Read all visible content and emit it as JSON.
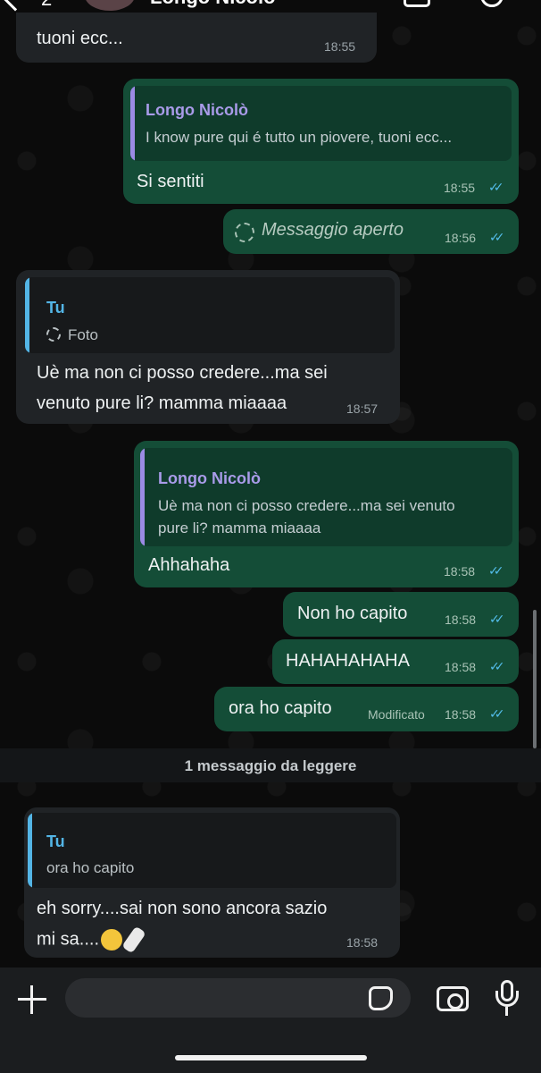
{
  "header": {
    "back_count": "2",
    "contact_name": "Longo Nicolò"
  },
  "messages": [
    {
      "text": "tuoni ecc...",
      "time": "18:55"
    },
    {
      "quote_name": "Longo Nicolò",
      "quote_text": "I know pure qui é tutto un piovere, tuoni ecc...",
      "text": "Si sentiti",
      "time": "18:55",
      "ticks": "✓✓"
    },
    {
      "text": "Messaggio aperto",
      "time": "18:56",
      "ticks": "✓✓"
    },
    {
      "quote_name": "Tu",
      "quote_text": "Foto",
      "text_line1": "Uè ma non ci posso credere...ma sei",
      "text_line2": "venuto pure li? mamma miaaaa",
      "time": "18:57"
    },
    {
      "quote_name": "Longo Nicolò",
      "quote_line1": "Uè ma non ci posso credere...ma sei venuto",
      "quote_line2": "pure li? mamma miaaaa",
      "text": "Ahhahaha",
      "time": "18:58",
      "ticks": "✓✓"
    },
    {
      "text": "Non ho capito",
      "time": "18:58",
      "ticks": "✓✓"
    },
    {
      "text": "HAHAHAHAHA",
      "time": "18:58",
      "ticks": "✓✓"
    },
    {
      "text": "ora ho capito",
      "edited": "Modificato",
      "time": "18:58",
      "ticks": "✓✓"
    }
  ],
  "unread_divider": "1 messaggio da leggere",
  "unread_message": {
    "quote_name": "Tu",
    "quote_text": "ora ho capito",
    "text_line1": "eh sorry....sai non sono ancora sazio",
    "text_line2": "mi sa....",
    "time": "18:58"
  },
  "composer": {
    "placeholder": ""
  },
  "colors": {
    "outgoing_bubble": "#144d37",
    "incoming_bubble": "#202326",
    "read_ticks": "#53bdeb",
    "quote_name_contact": "#a99be9",
    "quote_name_self": "#53b5e6"
  },
  "icons": [
    "back-arrow-icon",
    "video-call-icon",
    "phone-icon",
    "plus-icon",
    "sticker-icon",
    "camera-icon",
    "microphone-icon",
    "view-once-icon"
  ]
}
